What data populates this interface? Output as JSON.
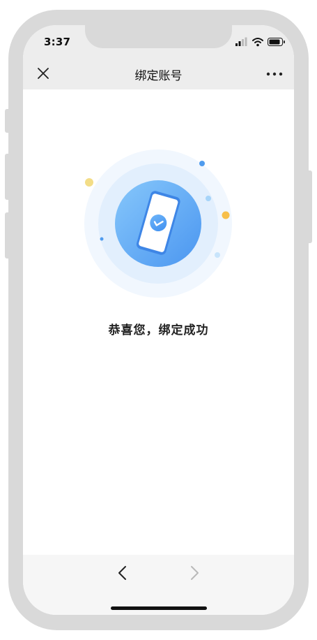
{
  "status_bar": {
    "time": "3:37"
  },
  "nav": {
    "title": "绑定账号"
  },
  "main": {
    "success_message": "恭喜您，绑定成功"
  },
  "colors": {
    "accent_blue": "#5aa7f5",
    "accent_yellow": "#f7bf4a",
    "nav_bg": "#ededed",
    "bottom_bg": "#f6f6f6"
  },
  "icons": {
    "close": "close-icon",
    "more": "more-dots-icon",
    "back": "chevron-left-icon",
    "forward": "chevron-right-icon",
    "illustration": "phone-check-icon"
  }
}
